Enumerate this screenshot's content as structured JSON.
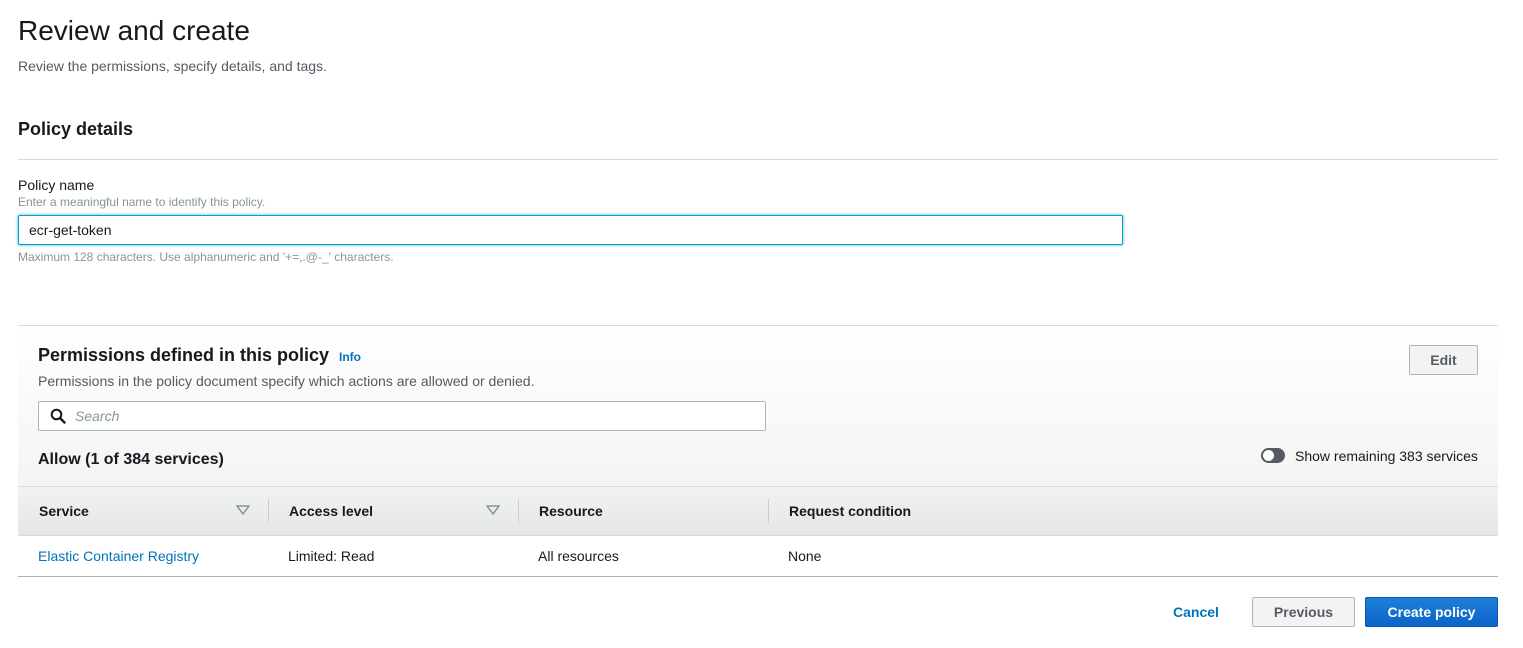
{
  "header": {
    "title": "Review and create",
    "subtitle": "Review the permissions, specify details, and tags."
  },
  "policy_details": {
    "section_title": "Policy details",
    "name_label": "Policy name",
    "name_description": "Enter a meaningful name to identify this policy.",
    "name_value": "ecr-get-token",
    "name_constraint": "Maximum 128 characters. Use alphanumeric and '+=,.@-_' characters."
  },
  "permissions": {
    "title": "Permissions defined in this policy",
    "info_label": "Info",
    "description": "Permissions in the policy document specify which actions are allowed or denied.",
    "edit_label": "Edit",
    "search_placeholder": "Search",
    "allow_title": "Allow (1 of 384 services)",
    "toggle_label": "Show remaining 383 services",
    "toggle_on": false,
    "columns": [
      "Service",
      "Access level",
      "Resource",
      "Request condition"
    ],
    "rows": [
      {
        "service": "Elastic Container Registry",
        "access_level": "Limited: Read",
        "resource": "All resources",
        "request_condition": "None"
      }
    ]
  },
  "footer": {
    "cancel_label": "Cancel",
    "previous_label": "Previous",
    "create_label": "Create policy"
  },
  "colors": {
    "primary": "#0b64c9",
    "link": "#0073bb",
    "input_focus": "#00a1c9"
  },
  "icons": {
    "search": "search-icon",
    "sort": "caret-down-icon"
  }
}
